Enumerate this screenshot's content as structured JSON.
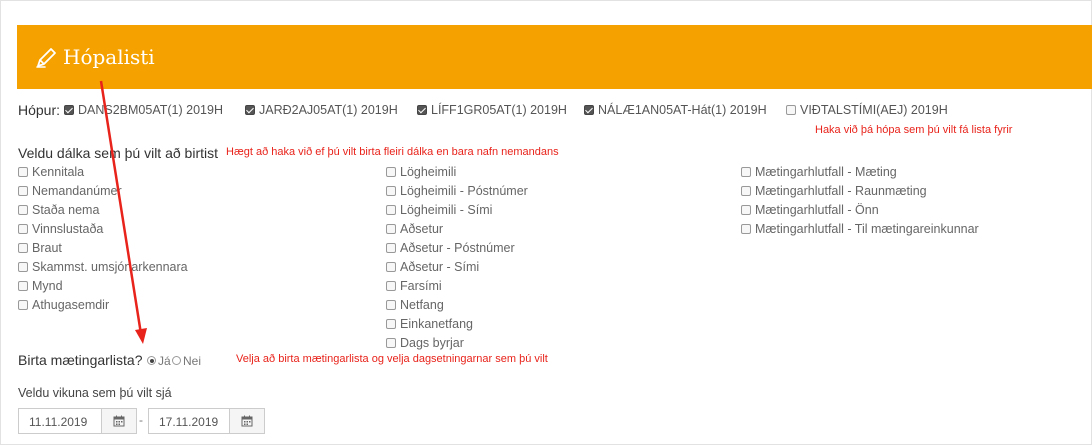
{
  "header": {
    "title": "Hópalisti",
    "icon": "pencil-icon",
    "color": "#f5a200"
  },
  "groups": {
    "label": "Hópur:",
    "items": [
      {
        "label": "DANS2BM05AT(1) 2019H",
        "checked": true
      },
      {
        "label": "JARÐ2AJ05AT(1) 2019H",
        "checked": true
      },
      {
        "label": "LÍFF1GR05AT(1) 2019H",
        "checked": true
      },
      {
        "label": "NÁLÆ1AN05AT-Hát(1) 2019H",
        "checked": true
      },
      {
        "label": "VIÐTALSTÍMI(AEJ) 2019H",
        "checked": false
      }
    ],
    "note": "Haka við þá hópa sem þú vilt fá lista fyrir"
  },
  "columns": {
    "label": "Veldu dálka sem þú vilt að birtist",
    "note": "Hægt að haka við ef þú vilt birta fleiri dálka en bara nafn nemandans",
    "col1": [
      "Kennitala",
      "Nemandanúmer",
      "Staða nema",
      "Vinnslustaða",
      "Braut",
      "Skammst. umsjónarkennara",
      "Mynd",
      "Athugasemdir"
    ],
    "col2": [
      "Lögheimili",
      "Lögheimili - Póstnúmer",
      "Lögheimili - Sími",
      "Aðsetur",
      "Aðsetur - Póstnúmer",
      "Aðsetur - Sími",
      "Farsími",
      "Netfang",
      "Einkanetfang",
      "Dags byrjar"
    ],
    "col3": [
      "Mætingarhlutfall - Mæting",
      "Mætingarhlutfall - Raunmæting",
      "Mætingarhlutfall - Önn",
      "Mætingarhlutfall - Til mætingareinkunnar"
    ]
  },
  "attendance": {
    "label": "Birta mætingarlista?",
    "yes": "Já",
    "no": "Nei",
    "selected": "Já",
    "note": "Velja að birta mætingarlista og velja dagsetningarnar sem þú vilt"
  },
  "week": {
    "label": "Veldu vikuna sem þú vilt sjá",
    "from": "11.11.2019",
    "separator": "-",
    "to": "17.11.2019"
  },
  "colors": {
    "annotation": "#e8231b",
    "banner": "#f5a200"
  }
}
